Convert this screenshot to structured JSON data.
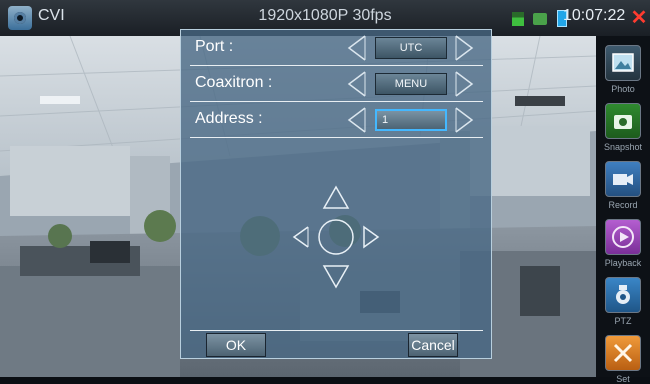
{
  "topbar": {
    "mode": "CVI",
    "resolution": "1920x1080P 30fps",
    "time": "10:07:22",
    "close_icon": "✕"
  },
  "sidebar": {
    "items": [
      {
        "label": "Photo",
        "icon": "photo-icon"
      },
      {
        "label": "Snapshot",
        "icon": "camera-icon"
      },
      {
        "label": "Record",
        "icon": "video-camera-icon"
      },
      {
        "label": "Playback",
        "icon": "play-icon"
      },
      {
        "label": "PTZ",
        "icon": "ptz-camera-icon"
      },
      {
        "label": "Set",
        "icon": "tools-icon"
      }
    ]
  },
  "dialog": {
    "rows": [
      {
        "label": "Port :",
        "value": "UTC"
      },
      {
        "label": "Coaxitron :",
        "value": "MENU"
      },
      {
        "label": "Address :",
        "value": "1"
      }
    ],
    "ok_label": "OK",
    "cancel_label": "Cancel"
  }
}
